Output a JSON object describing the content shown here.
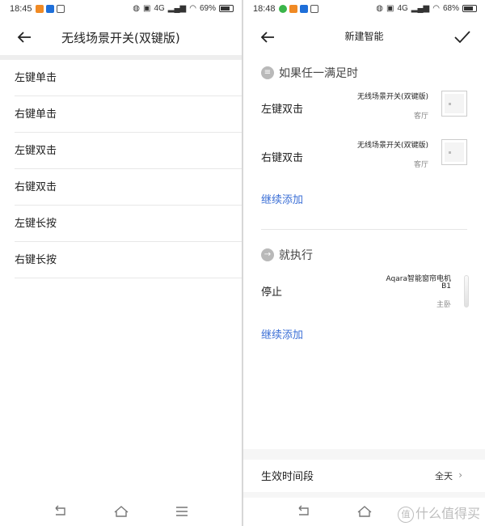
{
  "left": {
    "status": {
      "time": "18:45",
      "network": "4G",
      "battery": "69%",
      "battery_level": 0.69
    },
    "header": {
      "title": "无线场景开关(双键版)"
    },
    "items": [
      {
        "label": "左键单击"
      },
      {
        "label": "右键单击"
      },
      {
        "label": "左键双击"
      },
      {
        "label": "右键双击"
      },
      {
        "label": "左键长按"
      },
      {
        "label": "右键长按"
      }
    ]
  },
  "right": {
    "status": {
      "time": "18:48",
      "network": "4G",
      "battery": "68%",
      "battery_level": 0.68
    },
    "header": {
      "title": "新建智能"
    },
    "conditions": {
      "heading": "如果任一满足时",
      "items": [
        {
          "label": "左键双击",
          "device": "无线场景开关(双键版)",
          "room": "客厅"
        },
        {
          "label": "右键双击",
          "device": "无线场景开关(双键版)",
          "room": "客厅"
        }
      ],
      "add_label": "继续添加"
    },
    "actions": {
      "heading": "就执行",
      "items": [
        {
          "label": "停止",
          "device_line1": "Aqara智能窗帘电机",
          "device_line2": "B1",
          "room": "主卧"
        }
      ],
      "add_label": "继续添加"
    },
    "effective_time": {
      "label": "生效时间段",
      "value": "全天"
    },
    "watermark": {
      "logo": "值",
      "text": "什么值得买"
    }
  },
  "colors": {
    "link": "#3b6fd6",
    "divider": "#e8e8e8",
    "band": "#eeeeee"
  },
  "icons": {
    "back": "arrow-left-icon",
    "confirm": "check-icon",
    "nav_back": "nav-back-icon",
    "nav_home": "nav-home-icon",
    "nav_menu": "nav-menu-icon"
  }
}
